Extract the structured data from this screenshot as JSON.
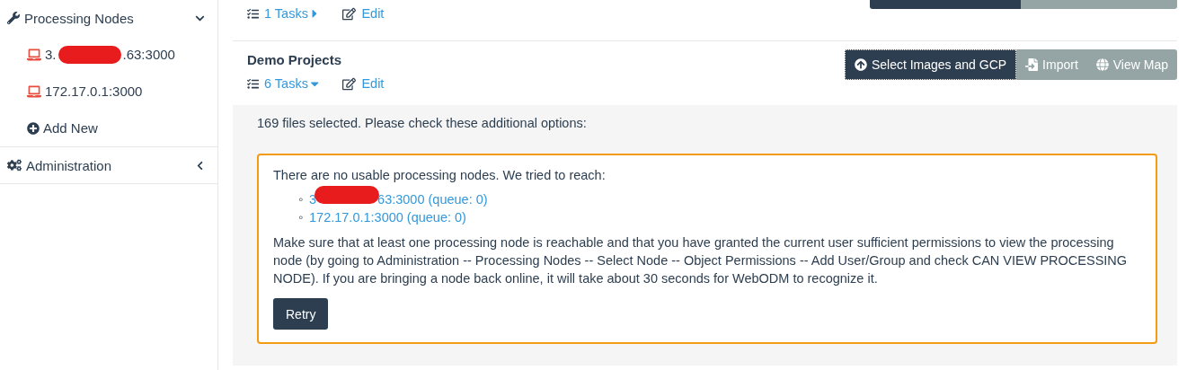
{
  "sidebar": {
    "sections": [
      {
        "kind": "nodes",
        "label": "Processing Nodes",
        "expanded": true,
        "items": [
          {
            "kind": "node",
            "prefix": "3.",
            "suffix": ".63:3000",
            "redacted": true
          },
          {
            "kind": "node",
            "prefix": "172.17.0.1:3000",
            "redacted": false
          },
          {
            "kind": "add",
            "prefix": "Add New",
            "redacted": false
          }
        ]
      },
      {
        "kind": "admin",
        "label": "Administration",
        "expanded": false
      }
    ]
  },
  "projects": [
    {
      "tasks": "1 Tasks",
      "expanded": false,
      "edit": "Edit"
    },
    {
      "name": "Demo Projects",
      "tasks": "6 Tasks",
      "expanded": true,
      "edit": "Edit",
      "buttons": [
        {
          "kind": "upload",
          "label": "Select Images and GCP",
          "selected": true
        },
        {
          "kind": "import",
          "label": "Import",
          "selected": false
        },
        {
          "kind": "map",
          "label": "View Map",
          "selected": false
        }
      ]
    }
  ],
  "upload_panel": {
    "message": "169 files selected. Please check these additional options:",
    "alert": {
      "intro": "There are no usable processing nodes. We tried to reach:",
      "nodes": [
        {
          "marker": "◦",
          "prefix": "3",
          "suffix": "63:3000 (queue: 0)",
          "redacted": true
        },
        {
          "marker": "◦",
          "prefix": "172.17.0.1:3000 (queue: 0)",
          "redacted": false
        }
      ],
      "body": "Make sure that at least one processing node is reachable and that you have granted the current user sufficient permissions to view the processing node (by going to Administration -- Processing Nodes -- Select Node -- Object Permissions -- Add User/Group and check CAN VIEW PROCESSING NODE). If you are bringing a node back online, it will take about 30 seconds for WebODM to recognize it.",
      "retry": "Retry"
    }
  }
}
